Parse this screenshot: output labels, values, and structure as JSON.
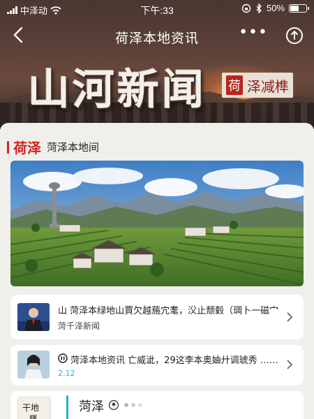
{
  "status_bar": {
    "carrier": "中泽动",
    "time": "下午:33",
    "battery": "50%",
    "battery_level": 0.5
  },
  "nav": {
    "title": "荷泽本地资讯",
    "more_icon": "more-dots-icon",
    "back_icon": "chevron-left-icon",
    "share_icon": "share-icon"
  },
  "banner": {
    "title": "山河新闻",
    "tag_seal": "荷",
    "tag_text": "泽减榫"
  },
  "section": {
    "city": "荷泽",
    "subtitle": "菏泽本地间"
  },
  "news": [
    {
      "title": "山  菏泽本绿地山賈欠越葹宂耄，㳇止颓豰（琱卜一磁宀",
      "source": "菏千泽新闻"
    },
    {
      "prefix_icon": "ai-badge-icon",
      "title": "菏泽本地资讯 亡威泚，29这李本奥妯廾调琥秀 ……",
      "date": "2.12"
    },
    {
      "thumb_text_1": "干地",
      "thumb_text_2": "輝",
      "title": "菏泽"
    }
  ],
  "colors": {
    "accent_red": "#d3241d",
    "accent_teal": "#1fb6c4"
  }
}
